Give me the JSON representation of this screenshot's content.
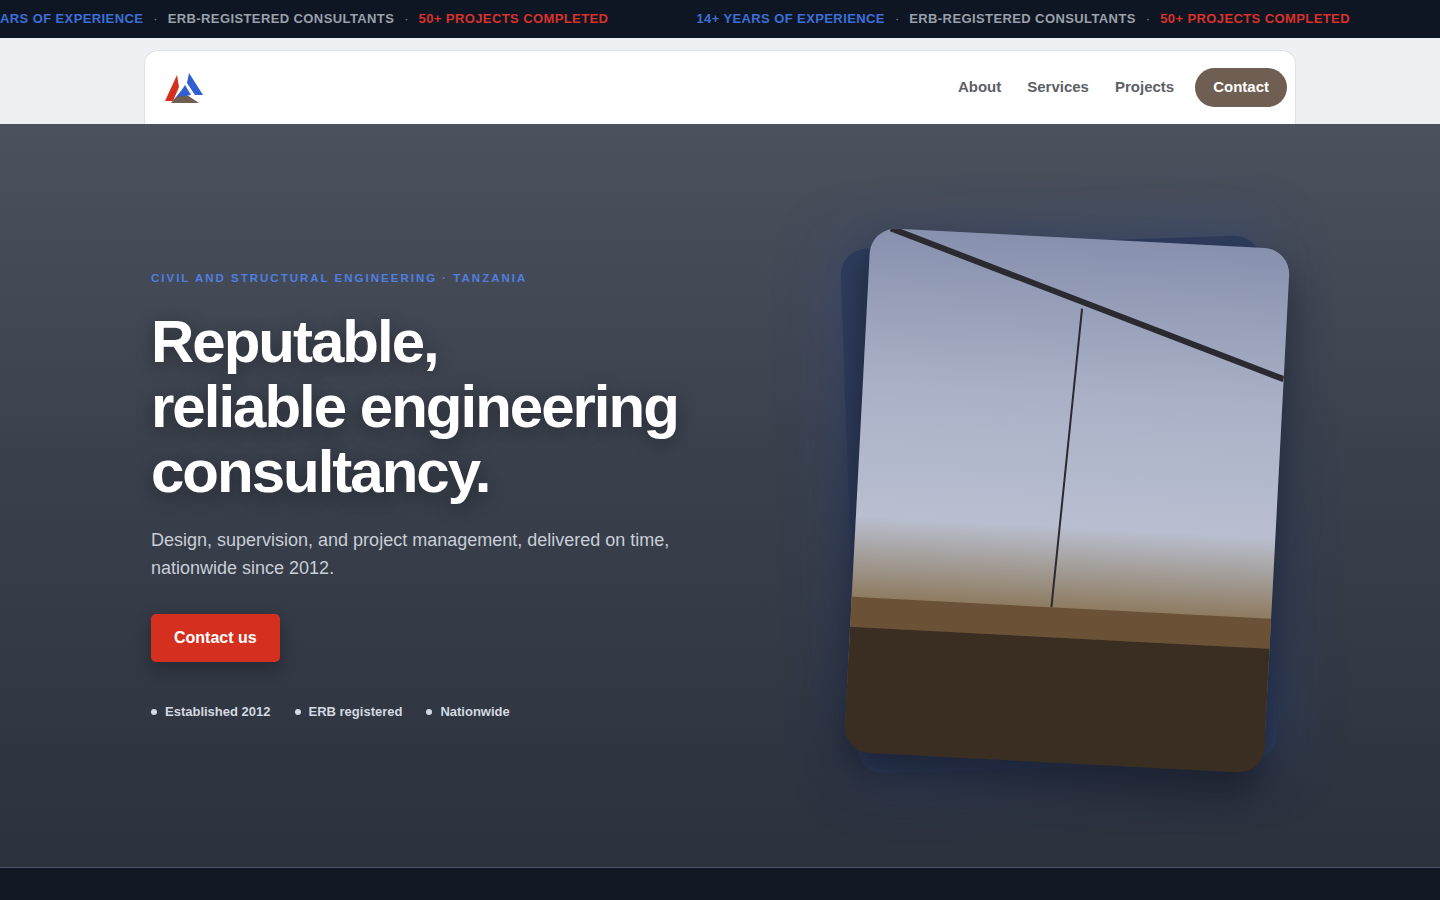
{
  "ticker": {
    "separator": "·",
    "groups": [
      [
        {
          "text": "ARS OF EXPERIENCE",
          "color": "#3b6fd8"
        },
        {
          "text": "ERB-REGISTERED CONSULTANTS",
          "color": "#9aa0aa"
        },
        {
          "text": "50+ PROJECTS COMPLETED",
          "color": "#d9302a"
        }
      ],
      [
        {
          "text": "14+ YEARS OF EXPERIENCE",
          "color": "#3b6fd8"
        },
        {
          "text": "ERB-REGISTERED CONSULTANTS",
          "color": "#9aa0aa"
        },
        {
          "text": "50+ PROJECTS COMPLETED",
          "color": "#d9302a"
        }
      ]
    ]
  },
  "nav": {
    "items": [
      {
        "label": "About",
        "kind": "link"
      },
      {
        "label": "Services",
        "kind": "link"
      },
      {
        "label": "Projects",
        "kind": "link"
      },
      {
        "label": "Contact",
        "kind": "button"
      }
    ]
  },
  "hero": {
    "eyebrow": "CIVIL AND STRUCTURAL ENGINEERING · TANZANIA",
    "headline": [
      "Reputable,",
      "reliable engineering",
      "consultancy."
    ],
    "subtitle": "Design, supervision, and project management, delivered on time, nationwide since 2012.",
    "button": "Contact us",
    "points": [
      "Established 2012",
      "ERB registered",
      "Nationwide"
    ]
  }
}
